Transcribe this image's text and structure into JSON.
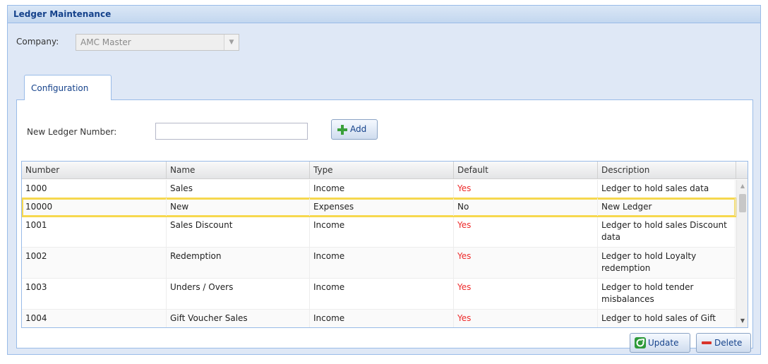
{
  "window": {
    "title": "Ledger Maintenance"
  },
  "company": {
    "label": "Company:",
    "value": "AMC Master"
  },
  "tabs": [
    {
      "label": "Configuration",
      "active": true
    }
  ],
  "new_ledger": {
    "label": "New Ledger Number:",
    "value": "",
    "add_label": "Add"
  },
  "grid": {
    "columns": [
      "Number",
      "Name",
      "Type",
      "Default",
      "Description"
    ],
    "rows": [
      {
        "number": "1000",
        "name": "Sales",
        "type": "Income",
        "default": "Yes",
        "description": "Ledger to hold sales data"
      },
      {
        "number": "10000",
        "name": "New",
        "type": "Expenses",
        "default": "No",
        "description": "New Ledger",
        "selected": true
      },
      {
        "number": "1001",
        "name": "Sales Discount",
        "type": "Income",
        "default": "Yes",
        "description": "Ledger to hold sales Discount data"
      },
      {
        "number": "1002",
        "name": "Redemption",
        "type": "Income",
        "default": "Yes",
        "description": "Ledger to hold Loyalty redemption"
      },
      {
        "number": "1003",
        "name": "Unders / Overs",
        "type": "Income",
        "default": "Yes",
        "description": "Ledger to hold tender misbalances"
      },
      {
        "number": "1004",
        "name": "Gift Voucher Sales",
        "type": "Income",
        "default": "Yes",
        "description": "Ledger to hold sales of Gift"
      }
    ]
  },
  "actions": {
    "update_label": "Update",
    "delete_label": "Delete"
  },
  "colors": {
    "header_text": "#15428b",
    "panel_border": "#99bbe8",
    "default_yes": "#ee2b2b",
    "selection_highlight": "#f6d84e",
    "add_icon": "#3aa03a",
    "update_icon": "#2e9a3a",
    "delete_icon": "#d9342b"
  }
}
